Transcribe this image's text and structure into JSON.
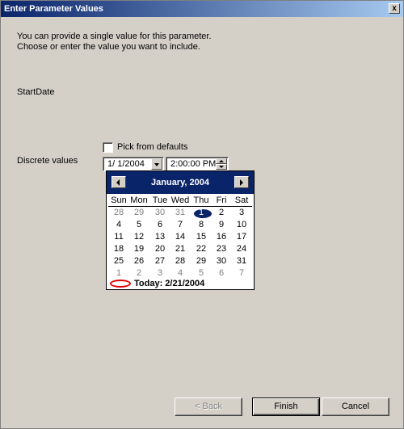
{
  "window": {
    "title": "Enter Parameter Values",
    "close_glyph": "x"
  },
  "intro": {
    "line1": "You can provide a single value for this parameter.",
    "line2": "Choose or enter the value you want to include."
  },
  "parameter_name": "StartDate",
  "discrete_label": "Discrete values",
  "pick_defaults": {
    "label": "Pick from defaults",
    "checked": false
  },
  "date_field": {
    "value": "1/  1/2004"
  },
  "time_field": {
    "value": "2:00:00 PM"
  },
  "calendar": {
    "month_label": "January, 2004",
    "days_of_week": [
      "Sun",
      "Mon",
      "Tue",
      "Wed",
      "Thu",
      "Fri",
      "Sat"
    ],
    "weeks": [
      [
        "28",
        "29",
        "30",
        "31",
        "1",
        "2",
        "3"
      ],
      [
        "4",
        "5",
        "6",
        "7",
        "8",
        "9",
        "10"
      ],
      [
        "11",
        "12",
        "13",
        "14",
        "15",
        "16",
        "17"
      ],
      [
        "18",
        "19",
        "20",
        "21",
        "22",
        "23",
        "24"
      ],
      [
        "25",
        "26",
        "27",
        "28",
        "29",
        "30",
        "31"
      ],
      [
        "1",
        "2",
        "3",
        "4",
        "5",
        "6",
        "7"
      ]
    ],
    "selected_day": "1",
    "today_label": "Today: 2/21/2004",
    "header_color": "#0a246a",
    "today_marker_color": "#e00000"
  },
  "buttons": {
    "back": "< Back",
    "finish": "Finish",
    "cancel": "Cancel"
  }
}
